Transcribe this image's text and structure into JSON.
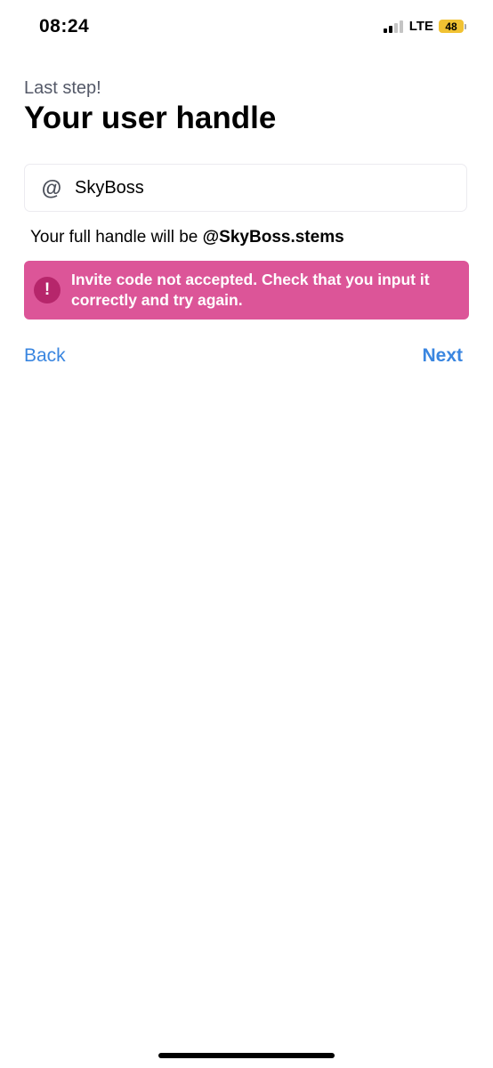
{
  "status_bar": {
    "time": "08:24",
    "network": "LTE",
    "battery": "48",
    "signal_bars_filled": 2,
    "signal_bars_total": 4,
    "battery_color": "#f1c232"
  },
  "header": {
    "subtitle": "Last step!",
    "title": "Your user handle"
  },
  "handle_input": {
    "prefix_icon": "at-icon",
    "prefix_symbol": "@",
    "value": "SkyBoss"
  },
  "full_handle": {
    "prefix": "Your full handle will be ",
    "handle": "@SkyBoss.stems"
  },
  "error": {
    "icon": "exclamation-icon",
    "icon_symbol": "!",
    "message": "Invite code not accepted. Check that you input it correctly and try again.",
    "background_color": "#dc5598"
  },
  "nav": {
    "back_label": "Back",
    "next_label": "Next",
    "accent_color": "#3a86e0"
  }
}
